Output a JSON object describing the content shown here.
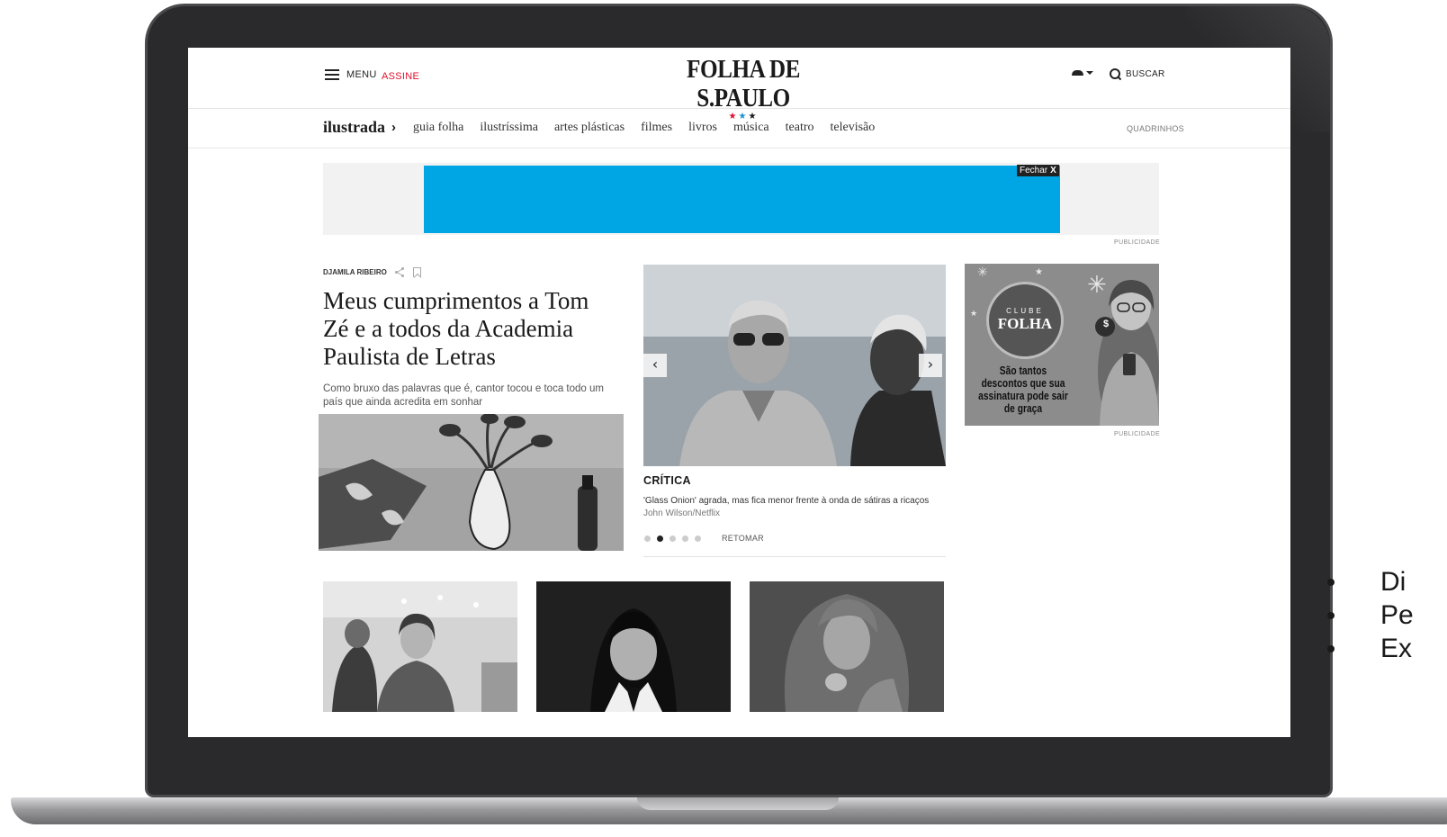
{
  "header": {
    "menu_label": "MENU",
    "subscribe_label": "ASSINE",
    "logo_text": "FOLHA DE S.PAULO",
    "logo_stars": [
      "★",
      "★",
      "★"
    ],
    "search_label": "BUSCAR",
    "icons": {
      "menu": "hamburger-icon",
      "user": "user-icon",
      "search": "search-icon"
    }
  },
  "section_nav": {
    "section": "ilustrada",
    "separator": "›",
    "links": [
      "guia folha",
      "ilustríssima",
      "artes plásticas",
      "filmes",
      "livros",
      "música",
      "teatro",
      "televisão"
    ],
    "right_link": "QUADRINHOS"
  },
  "ad_banner": {
    "close_label": "Fechar",
    "close_x": "X",
    "publicity_label": "PUBLICIDADE",
    "color": "#00a6e4"
  },
  "lead_article": {
    "author": "DJAMILA RIBEIRO",
    "headline": "Meus cumprimentos a Tom Zé e a todos da Academia Paulista de Letras",
    "summary": "Como bruxo das palavras que é, cantor tocou e toca todo um país que ainda acredita em sonhar"
  },
  "carousel": {
    "kicker": "CRÍTICA",
    "title": "'Glass Onion' agrada, mas fica menor frente à onda de sátiras a ricaços",
    "credit": "John Wilson/Netflix",
    "prev_label": "‹",
    "next_label": "›",
    "slide_count": 5,
    "active_slide": 2,
    "resume_label": "RETOMAR"
  },
  "side_ad": {
    "brand_top": "CLUBE",
    "brand_bottom": "FOLHA",
    "text": "São tantos descontos que sua assinatura pode sair de graça",
    "money_symbol": "$",
    "publicity_label": "PUBLICIDADE"
  },
  "slide_bullets": [
    "Di",
    "Pe",
    "Ex"
  ]
}
